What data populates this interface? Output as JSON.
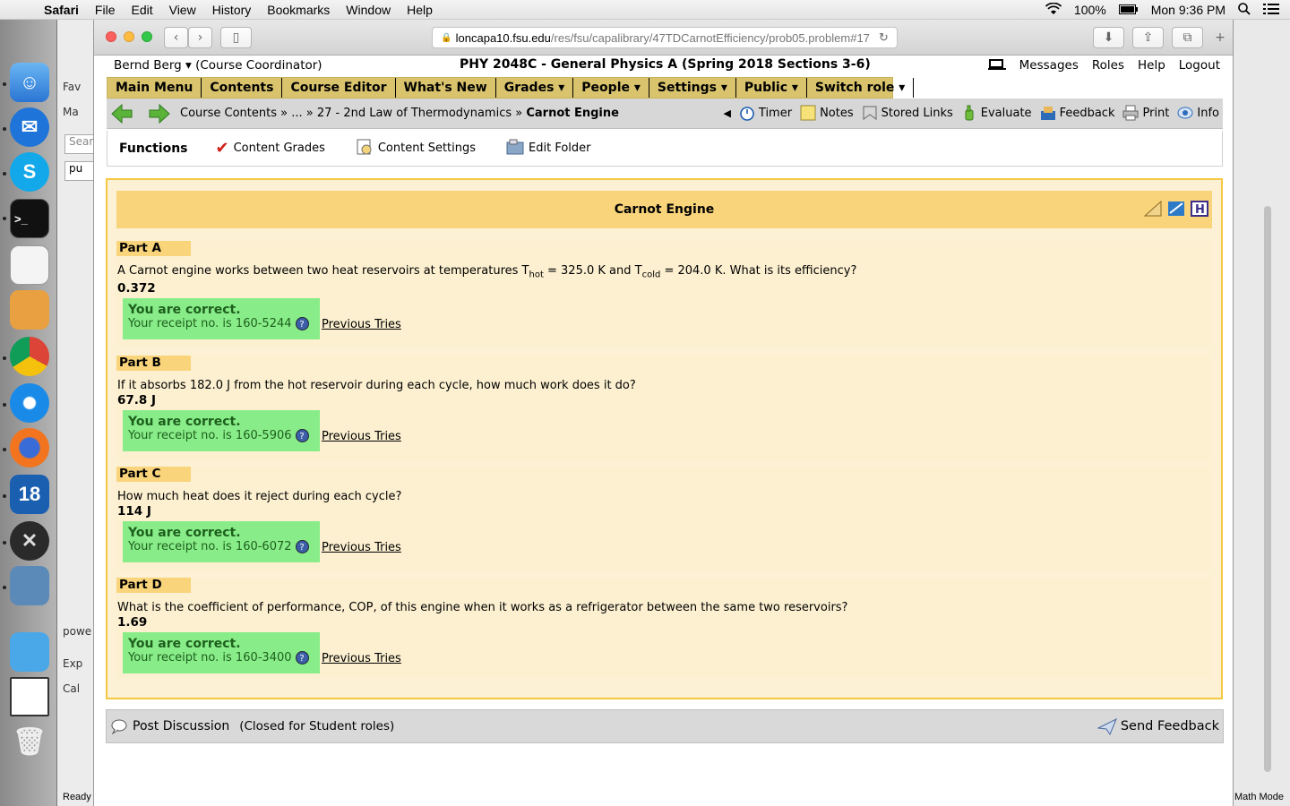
{
  "menubar": {
    "app": "Safari",
    "items": [
      "File",
      "Edit",
      "View",
      "History",
      "Bookmarks",
      "Window",
      "Help"
    ],
    "battery": "100%",
    "clock": "Mon 9:36 PM"
  },
  "browser": {
    "url_host": "loncapa10.fsu.edu",
    "url_path": "/res/fsu/capalibrary/47TDCarnotEfficiency/prob05.problem#17"
  },
  "header": {
    "user": "Bernd Berg ▾ (Course Coordinator)",
    "course": "PHY 2048C - General Physics A (Spring 2018 Sections 3-6)",
    "links": [
      "Messages",
      "Roles",
      "Help",
      "Logout"
    ]
  },
  "mainnav": [
    "Main Menu",
    "Contents",
    "Course Editor",
    "What's New",
    "Grades ▾",
    "People ▾",
    "Settings ▾",
    "Public ▾",
    "Switch role ▾"
  ],
  "breadcrumb": {
    "path": "Course Contents » ... » 27 - 2nd Law of Thermodynamics »",
    "current": "Carnot Engine"
  },
  "tools": [
    "Timer",
    "Notes",
    "Stored Links",
    "Evaluate",
    "Feedback",
    "Print",
    "Info"
  ],
  "functions": {
    "title": "Functions",
    "items": [
      "Content Grades",
      "Content Settings",
      "Edit Folder"
    ]
  },
  "problem": {
    "title": "Carnot Engine",
    "parts": [
      {
        "label": "Part A",
        "q_pre": "A Carnot engine works between two heat reservoirs at temperatures T",
        "sub1": "hot",
        "q_mid": " = 325.0 K and T",
        "sub2": "cold",
        "q_post": " = 204.0 K. What is its efficiency?",
        "answer": "0.372",
        "status": "You are correct.",
        "receipt": "Your receipt no. is 160-5244",
        "prev": "Previous Tries"
      },
      {
        "label": "Part B",
        "q_pre": "If it absorbs 182.0 J from the hot reservoir during each cycle, how much work does it do?",
        "sub1": "",
        "q_mid": "",
        "sub2": "",
        "q_post": "",
        "answer": "67.8 J",
        "status": "You are correct.",
        "receipt": "Your receipt no. is 160-5906",
        "prev": "Previous Tries"
      },
      {
        "label": "Part C",
        "q_pre": "How much heat does it reject during each cycle?",
        "sub1": "",
        "q_mid": "",
        "sub2": "",
        "q_post": "",
        "answer": "114 J",
        "status": "You are correct.",
        "receipt": "Your receipt no. is 160-6072",
        "prev": "Previous Tries"
      },
      {
        "label": "Part D",
        "q_pre": "What is the coefficient of performance, COP, of this engine when it works as a refrigerator between the same two reservoirs?",
        "sub1": "",
        "q_mid": "",
        "sub2": "",
        "q_post": "",
        "answer": "1.69",
        "status": "You are correct.",
        "receipt": "Your receipt no. is 160-3400",
        "prev": "Previous Tries"
      }
    ]
  },
  "discussion": {
    "post": "Post Discussion",
    "closed": "(Closed for Student roles)",
    "send": "Send Feedback"
  },
  "background": {
    "left_fragments": [
      "Fav",
      "Ma",
      "Sear",
      "pu",
      "powe",
      "Exp",
      "Cal"
    ],
    "status_left": "Ready",
    "status_right": "Math Mode"
  }
}
